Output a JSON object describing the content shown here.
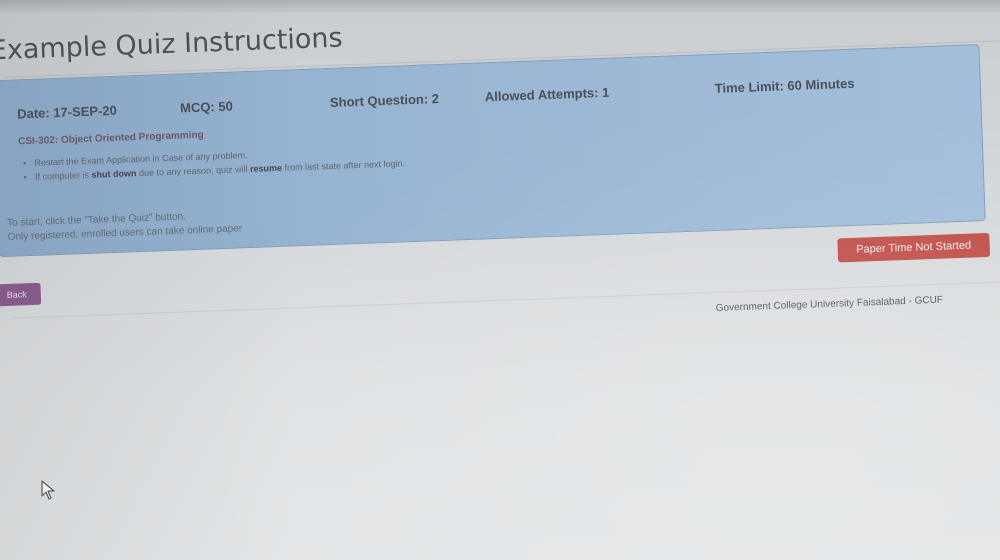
{
  "page": {
    "title": "Example Quiz Instructions"
  },
  "exam_info": {
    "date": "Date: 17-SEP-20",
    "mcq": "MCQ: 50",
    "short_question": "Short Question: 2",
    "allowed_attempts": "Allowed Attempts: 1",
    "time_limit": "Time Limit: 60 Minutes",
    "course": "CSI-302: Object Oriented Programming"
  },
  "rules": [
    {
      "before": "Restart the Exam Application in Case of any problem.",
      "bold_1": "",
      "middle": "",
      "bold_2": "",
      "after": ""
    },
    {
      "before": "If computer is ",
      "bold_1": "shut down",
      "middle": " due to any reason, quiz will ",
      "bold_2": "resume",
      "after": " from last state after next login."
    }
  ],
  "notes": {
    "start_instruction": "To start, click the \"Take the Quiz\" button.",
    "registration_note": "Only registered, enrolled users can take online paper"
  },
  "buttons": {
    "paper_status": "Paper Time Not Started",
    "back": "Back"
  },
  "footer": {
    "text": "Government College University Faisalabad - GCUF"
  },
  "colors": {
    "panel": "#9ab6d4",
    "status_button": "#c14f4a",
    "back_button": "#8b5c8e"
  },
  "icons": {
    "cursor": "mouse-pointer-icon"
  }
}
